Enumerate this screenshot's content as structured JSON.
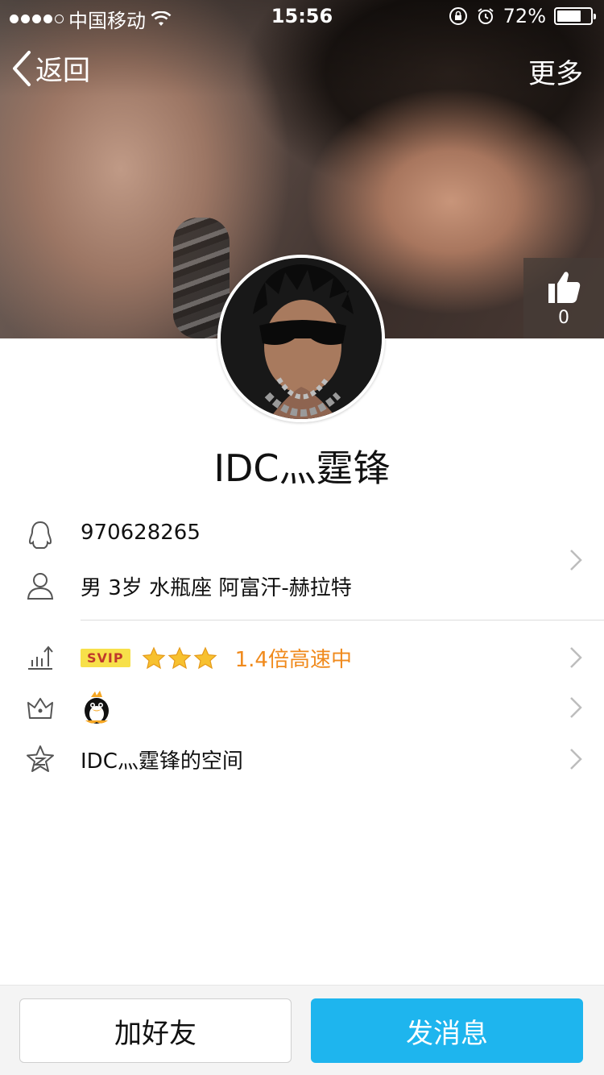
{
  "status_bar": {
    "carrier": "中国移动",
    "time": "15:56",
    "battery": "72%",
    "battery_level": 0.72
  },
  "nav": {
    "back_label": "返回",
    "more_label": "更多"
  },
  "like": {
    "count": "0"
  },
  "profile": {
    "name": "IDC灬霆锋",
    "qq_number": "970628265",
    "details": "男 3岁 水瓶座 阿富汗-赫拉特",
    "vip_badge": "SVIP",
    "vip_stars": 3,
    "speed_text": "1.4倍高速中",
    "space_label": "IDC灬霆锋的空间"
  },
  "actions": {
    "add_friend": "加好友",
    "send_message": "发消息"
  },
  "colors": {
    "accent": "#1eb5ee",
    "speed": "#f08a1c",
    "svip_bg": "#f7e04a",
    "svip_text": "#c0392b"
  },
  "icons": {
    "qq": "penguin-outline-icon",
    "person": "person-outline-icon",
    "level": "level-chart-icon",
    "vip": "crown-icon",
    "space": "qzone-star-icon",
    "like": "thumbs-up-icon",
    "chevron": "chevron-right-icon"
  }
}
